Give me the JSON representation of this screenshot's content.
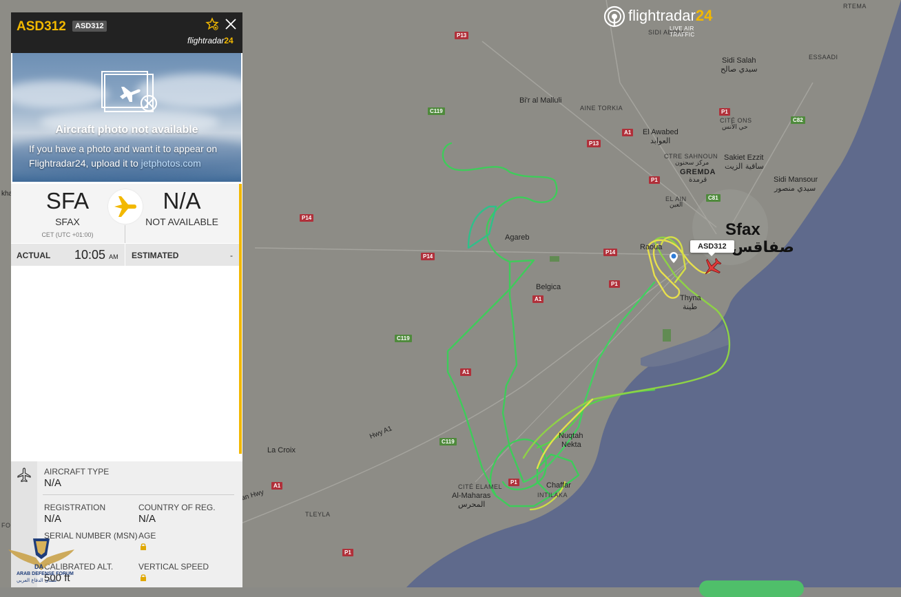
{
  "flight": {
    "callsign": "ASD312",
    "badge": "ASD312",
    "brand_prefix": "flightradar",
    "brand_suffix": "24"
  },
  "photo": {
    "title": "Aircraft photo not available",
    "desc": "If you have a photo and want it to appear on Flightradar24, upload it to ",
    "link": "jetphotos.com"
  },
  "route": {
    "origin_code": "SFA",
    "origin_city": "SFAX",
    "origin_tz": "CET (UTC +01:00)",
    "dest_code": "N/A",
    "dest_city": "NOT AVAILABLE"
  },
  "times": {
    "actual_label": "ACTUAL",
    "actual_value": "10:05",
    "actual_ampm": "AM",
    "estimated_label": "ESTIMATED",
    "estimated_value": "-"
  },
  "details": {
    "aircraft_type_label": "AIRCRAFT TYPE",
    "aircraft_type_value": "N/A",
    "registration_label": "REGISTRATION",
    "registration_value": "N/A",
    "country_label": "COUNTRY OF REG.",
    "country_value": "N/A",
    "serial_label": "SERIAL NUMBER (MSN)",
    "age_label": "AGE",
    "calibrated_label": "CALIBRATED ALT.",
    "calibrated_value": "500 ft",
    "vspeed_label": "VERTICAL SPEED"
  },
  "map": {
    "logo_title_a": "flightradar",
    "logo_title_b": "24",
    "logo_sub": "LIVE AIR TRAFFIC",
    "callout": "ASD312",
    "labels": {
      "sfax": "Sfax",
      "sfax_ar": "صفاقس",
      "sidi_salah": "Sidi Salah",
      "sidi_salah_ar": "سيدي صالح",
      "essaadi": "ESSAADI",
      "bir_malluli": "Bi'r al Malluli",
      "aine_torkia": "AINE TORKIA",
      "el_awabed": "El Awabed",
      "el_awabed_ar": "العوابد",
      "cite_ons": "CITÉ ONS",
      "cite_ons_ar": "حي الأنس",
      "ctre_sahnoun": "CTRE SAHNOUN",
      "ctre_sahnoun_ar": "مركز سحنون",
      "sakiet_ezzit": "Sakiet Ezzit",
      "sakiet_ezzit_ar": "ساقية الزيت",
      "gremda": "GREMDA",
      "gremda_ar": "قرمدة",
      "sidi_mansour": "Sidi Mansour",
      "sidi_mansour_ar": "سيدي منصور",
      "el_ain": "EL AIN",
      "el_ain_ar": "العين",
      "agareb": "Agareb",
      "raouadi": "Raoua",
      "thyna": "Thyna",
      "thyna_ar": "طينة",
      "belgica": "Belgica",
      "la_croix": "La Croix",
      "nuqtah": "Nuqtah",
      "nekta": "Nekta",
      "chaffar": "Chaffar",
      "intilaka": "INTILAKA",
      "cite_elamel": "CITÉ ELAMEL",
      "al_maharas": "Al-Maharas",
      "al_maharas_ar": "المحرس",
      "tleyla": "TLEYLA",
      "hwy_a1": "Hwy A1",
      "an_hwy": "an Hwy",
      "sidi_abdel": "SIDI ABDEL",
      "rtema": "RTEMA",
      "kha": "kha",
      "fo": "FO"
    },
    "roads": {
      "p13a": "P13",
      "p13b": "P13",
      "c119a": "C119",
      "c119b": "C119",
      "c119c": "C119",
      "a1a": "A1",
      "a1b": "A1",
      "a1c": "A1",
      "a1d": "A1",
      "p14a": "P14",
      "p14b": "P14",
      "p14c": "P14",
      "p1a": "P1",
      "p1b": "P1",
      "p1c": "P1",
      "p1d": "P1",
      "p1e": "P1",
      "c82": "C82",
      "c81": "C81"
    }
  },
  "watermark": {
    "brand": "DA",
    "line1": "ARAB DEFENSE FORUM",
    "line2": "منتدى الدفاع العربي"
  },
  "colors": {
    "accent": "#f2b800",
    "panel_header": "#222222",
    "track_green": "#3ecc5a",
    "track_yellow": "#e3e04a"
  }
}
